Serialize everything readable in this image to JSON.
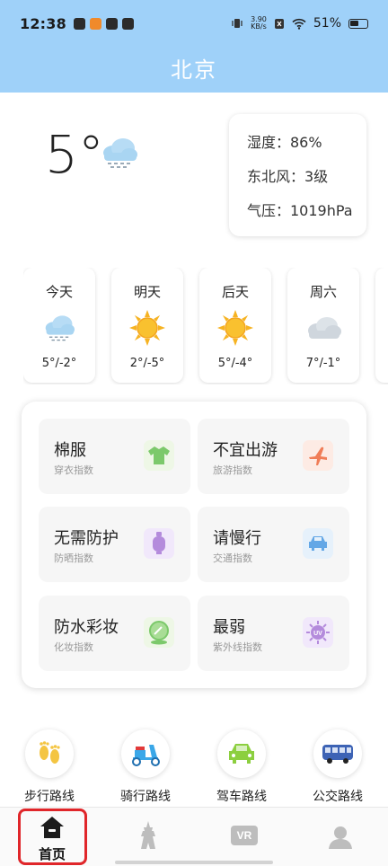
{
  "status_bar": {
    "time": "12:38",
    "speed_value": "3.90",
    "speed_unit": "KB/s",
    "battery": "51%"
  },
  "header": {
    "city": "北京"
  },
  "current": {
    "temperature": "5°",
    "icon": "snow-cloud-icon",
    "humidity": "湿度：86%",
    "wind": "东北风：3级",
    "pressure": "气压：1019hPa"
  },
  "forecast": [
    {
      "day": "今天",
      "range": "5°/-2°",
      "icon": "snow-cloud-icon"
    },
    {
      "day": "明天",
      "range": "2°/-5°",
      "icon": "sun-icon"
    },
    {
      "day": "后天",
      "range": "5°/-4°",
      "icon": "sun-icon"
    },
    {
      "day": "周六",
      "range": "7°/-1°",
      "icon": "cloudy-icon"
    }
  ],
  "indices": [
    {
      "title": "棉服",
      "sub": "穿衣指数",
      "icon": "shirt-icon",
      "color": "#7cc96b"
    },
    {
      "title": "不宜出游",
      "sub": "旅游指数",
      "icon": "airplane-icon",
      "color": "#f07d57"
    },
    {
      "title": "无需防护",
      "sub": "防晒指数",
      "icon": "bottle-icon",
      "color": "#b48bdc"
    },
    {
      "title": "请慢行",
      "sub": "交通指数",
      "icon": "car-icon",
      "color": "#63a7e6"
    },
    {
      "title": "防水彩妆",
      "sub": "化妆指数",
      "icon": "mirror-icon",
      "color": "#7cc96b"
    },
    {
      "title": "最弱",
      "sub": "紫外线指数",
      "icon": "uv-icon",
      "color": "#b48bdc"
    }
  ],
  "routes": [
    {
      "label": "步行路线",
      "icon": "footprints-icon"
    },
    {
      "label": "骑行路线",
      "icon": "scooter-icon"
    },
    {
      "label": "驾车路线",
      "icon": "car-icon"
    },
    {
      "label": "公交路线",
      "icon": "bus-icon"
    }
  ],
  "nav": {
    "home_label": "首页",
    "vr_text": "VR",
    "icons": [
      "home-icon",
      "tower-icon",
      "vr-icon",
      "profile-icon"
    ]
  }
}
